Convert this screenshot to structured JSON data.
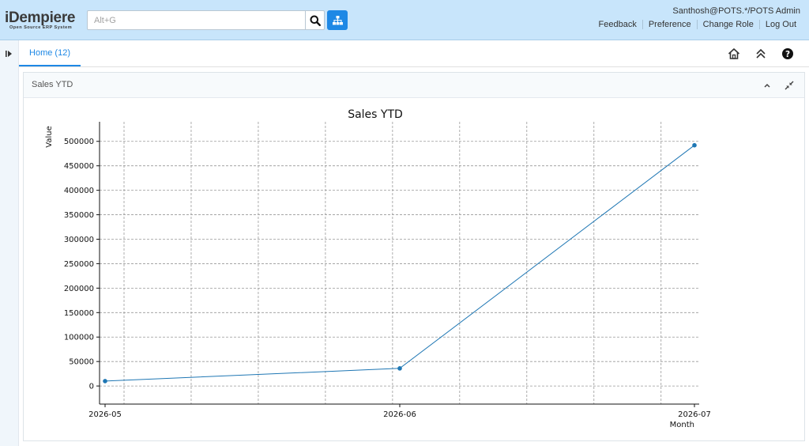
{
  "header": {
    "logo_text": "iDempiere",
    "logo_subtext": "Open Source ERP System",
    "search_placeholder": "Alt+G",
    "user": "Santhosh@POTS.*/POTS Admin",
    "links": [
      "Feedback",
      "Preference",
      "Change Role",
      "Log Out"
    ]
  },
  "tabs": [
    {
      "label": "Home (12)",
      "active": true
    }
  ],
  "panel": {
    "title": "Sales YTD"
  },
  "colors": {
    "header_bg": "#c8e5fb",
    "accent": "#1e88e5",
    "series": "#1f77b4"
  },
  "icons": {
    "search": "search-icon",
    "menu": "sitemap-icon",
    "home": "home-icon",
    "collapse_all": "double-chevron-up-icon",
    "help": "help-icon",
    "panel_collapse": "chevron-up-icon",
    "panel_minimize": "compress-icon",
    "expand_left": "expand-panel-icon"
  },
  "chart_data": {
    "type": "line",
    "title": "Sales YTD",
    "xlabel": "Month",
    "ylabel": "Value",
    "x": [
      "2026-05",
      "2026-06",
      "2026-07"
    ],
    "series": [
      {
        "values": [
          10000,
          36000,
          492000
        ]
      }
    ],
    "ylim": [
      -37000,
      540000
    ],
    "yticks": [
      0,
      50000,
      100000,
      150000,
      200000,
      250000,
      300000,
      350000,
      400000,
      450000,
      500000
    ],
    "grid": true
  }
}
